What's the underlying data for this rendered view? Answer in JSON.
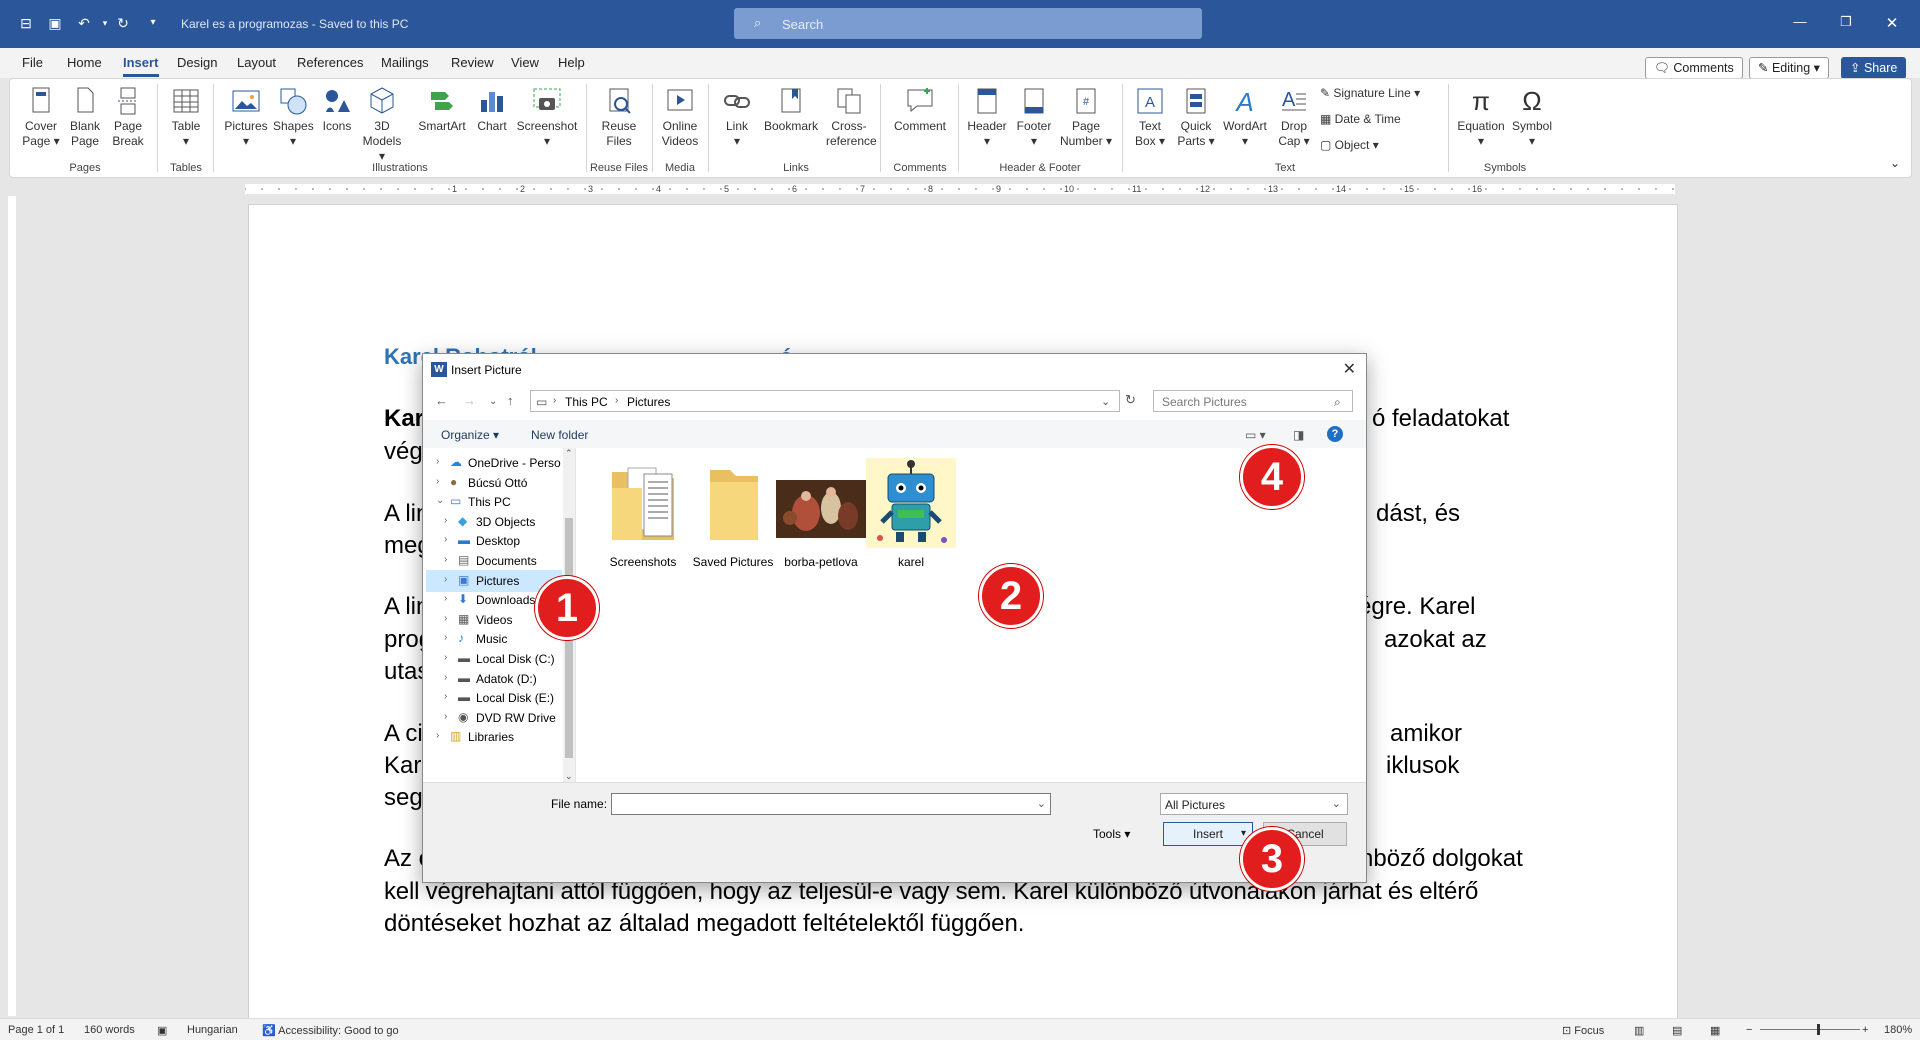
{
  "titlebar": {
    "doc_title": "Karel es a programozas  -  Saved to this PC",
    "search_placeholder": "Search"
  },
  "menubar": {
    "tabs": [
      "File",
      "Home",
      "Insert",
      "Design",
      "Layout",
      "References",
      "Mailings",
      "Review",
      "View",
      "Help"
    ],
    "active_tab": "Insert",
    "comments": "Comments",
    "editing": "Editing",
    "share": "Share"
  },
  "ribbon": {
    "cover_page": "Cover Page",
    "blank_page": "Blank Page",
    "page_break": "Page Break",
    "table": "Table",
    "pictures": "Pictures",
    "shapes": "Shapes",
    "icons": "Icons",
    "models_3d": "3D Models",
    "smartart": "SmartArt",
    "chart": "Chart",
    "screenshot": "Screenshot",
    "reuse_files": "Reuse Files",
    "online_videos": "Online Videos",
    "link": "Link",
    "bookmark": "Bookmark",
    "cross_reference": "Cross-reference",
    "comment": "Comment",
    "header": "Header",
    "footer": "Footer",
    "page_number": "Page Number",
    "text_box": "Text Box",
    "quick_parts": "Quick Parts",
    "wordart": "WordArt",
    "drop_cap": "Drop Cap",
    "signature_line": "Signature Line",
    "date_time": "Date & Time",
    "object": "Object",
    "equation": "Equation",
    "symbol": "Symbol",
    "groups": {
      "pages": "Pages",
      "tables": "Tables",
      "illustrations": "Illustrations",
      "reuse_files": "Reuse Files",
      "media": "Media",
      "links": "Links",
      "comments": "Comments",
      "header_footer": "Header & Footer",
      "text": "Text",
      "symbols": "Symbols"
    }
  },
  "ruler": {
    "labels": [
      "1",
      "2",
      "3",
      "4",
      "5",
      "6",
      "7",
      "8",
      "9",
      "10",
      "11",
      "12",
      "13",
      "14",
      "15",
      "16"
    ]
  },
  "document": {
    "heading": "Karel Robotról",
    "heading_end": "é",
    "p1_l1_start": "Kar",
    "p1_l1_end": "ó feladatokat",
    "p1_l2": "vég",
    "p2_l1_start": "A lin",
    "p2_l1_end": "dást, és",
    "p2_l2": "meg",
    "p3_l1_start": "A lin",
    "p3_l1_end": "égre. Karel",
    "p3_l2_start": "prog",
    "p3_l2_end": "azokat az",
    "p3_l3": "utas",
    "p4_l1_start": "A ci",
    "p4_l1_end": "amikor",
    "p4_l2_start": "Kar",
    "p4_l2_end": "iklusok",
    "p4_l3": "seg",
    "p5_l1_start": "Az e",
    "p5_l1_end": "nböző dolgokat",
    "p5_l2": "kell végrehajtani attól függően, hogy az teljesül-e vagy sem. Karel különböző útvonalakon járhat és eltérő",
    "p5_l3": "döntéseket hozhat az általad megadott feltételektől függően."
  },
  "dialog": {
    "title": "Insert Picture",
    "breadcrumb": [
      "This PC",
      "Pictures"
    ],
    "search_placeholder": "Search Pictures",
    "organize": "Organize",
    "new_folder": "New folder",
    "tree": [
      {
        "label": "OneDrive - Perso",
        "icon": "cloud-icon",
        "indent": 0,
        "expanded": false,
        "selected": false
      },
      {
        "label": "Búcsú Ottó",
        "icon": "user-icon",
        "indent": 0,
        "expanded": false,
        "selected": false
      },
      {
        "label": "This PC",
        "icon": "computer-icon",
        "indent": 0,
        "expanded": true,
        "selected": false
      },
      {
        "label": "3D Objects",
        "icon": "cube-icon",
        "indent": 1,
        "expanded": false,
        "selected": false
      },
      {
        "label": "Desktop",
        "icon": "desktop-icon",
        "indent": 1,
        "expanded": false,
        "selected": false
      },
      {
        "label": "Documents",
        "icon": "document-icon",
        "indent": 1,
        "expanded": false,
        "selected": false
      },
      {
        "label": "Pictures",
        "icon": "pictures-icon",
        "indent": 1,
        "expanded": false,
        "selected": true
      },
      {
        "label": "Downloads",
        "icon": "download-icon",
        "indent": 1,
        "expanded": false,
        "selected": false
      },
      {
        "label": "Videos",
        "icon": "video-icon",
        "indent": 1,
        "expanded": false,
        "selected": false
      },
      {
        "label": "Music",
        "icon": "music-icon",
        "indent": 1,
        "expanded": false,
        "selected": false
      },
      {
        "label": "Local Disk (C:)",
        "icon": "disk-icon",
        "indent": 1,
        "expanded": false,
        "selected": false
      },
      {
        "label": "Adatok (D:)",
        "icon": "disk-icon",
        "indent": 1,
        "expanded": false,
        "selected": false
      },
      {
        "label": "Local Disk (E:)",
        "icon": "disk-icon",
        "indent": 1,
        "expanded": false,
        "selected": false
      },
      {
        "label": "DVD RW Drive",
        "icon": "dvd-icon",
        "indent": 1,
        "expanded": false,
        "selected": false
      },
      {
        "label": "Libraries",
        "icon": "library-icon",
        "indent": 0,
        "expanded": false,
        "selected": false
      }
    ],
    "files": [
      {
        "label": "Screenshots",
        "kind": "folder-docs"
      },
      {
        "label": "Saved Pictures",
        "kind": "folder"
      },
      {
        "label": "borba-petlova",
        "kind": "photo"
      },
      {
        "label": "karel",
        "kind": "robot"
      }
    ],
    "file_name_label": "File name:",
    "file_name_value": "",
    "filter": "All Pictures",
    "tools": "Tools",
    "insert": "Insert",
    "cancel": "Cancel"
  },
  "badges": [
    "1",
    "2",
    "3",
    "4"
  ],
  "statusbar": {
    "page": "Page 1 of 1",
    "words": "160 words",
    "language": "Hungarian",
    "accessibility": "Accessibility: Good to go",
    "focus": "Focus",
    "zoom": "180%"
  },
  "colors": {
    "accent": "#2b579a",
    "heading": "#2e74b5",
    "badge": "#e21d1d",
    "selection": "#cce8ff"
  }
}
